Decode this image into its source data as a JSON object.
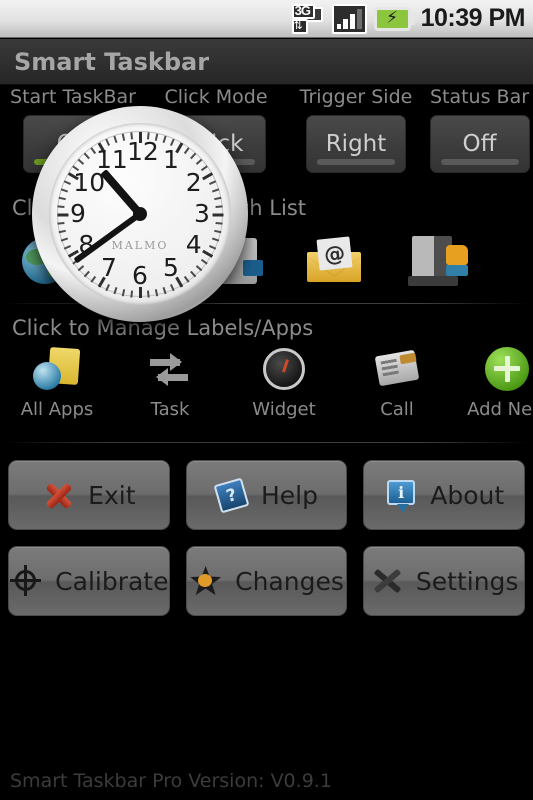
{
  "status_bar": {
    "time": "10:39 PM",
    "network_label": "3G",
    "network_arrows": "↕",
    "battery_glyph": "⚡",
    "signal_bars_filled": 3,
    "signal_bars_total": 4,
    "icons": [
      "3g-icon",
      "signal-icon",
      "battery-icon"
    ]
  },
  "app": {
    "title": "Smart Taskbar",
    "footer": "Smart Taskbar Pro Version: V0.9.1"
  },
  "settings": [
    {
      "label": "Start TaskBar",
      "value": "On",
      "state": "on"
    },
    {
      "label": "Click Mode",
      "value": "Click",
      "state": "off"
    },
    {
      "label": "Trigger Side",
      "value": "Right",
      "state": "off"
    },
    {
      "label": "Status Bar",
      "value": "Off",
      "state": "off"
    }
  ],
  "launch_section": {
    "header": "Click to Manage Launch List",
    "items": [
      {
        "icon": "browser-globe-icon"
      },
      {
        "icon": "app-icon"
      },
      {
        "icon": "email-icon",
        "glyph": "@"
      },
      {
        "icon": "file-manager-icon"
      }
    ]
  },
  "apps_section": {
    "header": "Click to Manage Labels/Apps",
    "items": [
      {
        "label": "All Apps",
        "icon": "all-apps-icon"
      },
      {
        "label": "Task",
        "icon": "task-arrows-icon"
      },
      {
        "label": "Widget",
        "icon": "widget-gauge-icon"
      },
      {
        "label": "Call",
        "icon": "call-phone-icon"
      },
      {
        "label": "Add New",
        "icon": "add-new-plus-icon"
      }
    ]
  },
  "buttons": [
    {
      "label": "Exit",
      "icon": "red-x-icon"
    },
    {
      "label": "Help",
      "icon": "blue-book-question-icon",
      "glyph": "?"
    },
    {
      "label": "About",
      "icon": "info-balloon-icon",
      "glyph": "i"
    },
    {
      "label": "Calibrate",
      "icon": "crosshair-icon"
    },
    {
      "label": "Changes",
      "icon": "star-icon"
    },
    {
      "label": "Settings",
      "icon": "hammer-wrench-icon"
    }
  ],
  "clock_widget": {
    "brand": "MALMO",
    "numbers": [
      "12",
      "1",
      "2",
      "3",
      "4",
      "5",
      "6",
      "7",
      "8",
      "9",
      "10",
      "11"
    ],
    "hour_angle": 319,
    "minute_angle": 234
  },
  "colors": {
    "accent_green": "#6d9b21",
    "background": "#000000",
    "title_bar": "#303030",
    "text_dim": "#8b8b8b"
  }
}
